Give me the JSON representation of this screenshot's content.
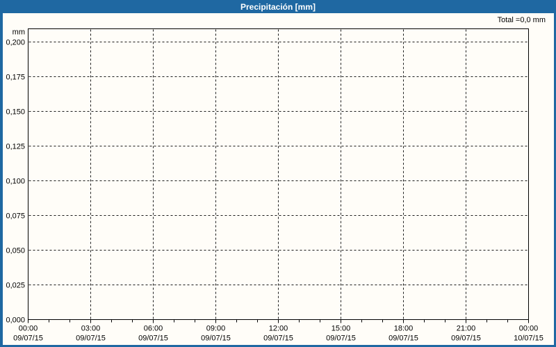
{
  "header": {
    "title": "Precipitación [mm]"
  },
  "summary": {
    "total_label": "Total =0,0 mm"
  },
  "chart_data": {
    "type": "line",
    "title": "Precipitación [mm]",
    "subtitle": "",
    "xlabel": "",
    "ylabel": "mm",
    "ylim": [
      0,
      0.21
    ],
    "y_tick_labels": [
      "0,200",
      "0,175",
      "0,150",
      "0,125",
      "0,100",
      "0,075",
      "0,050",
      "0,025",
      "0,000"
    ],
    "y_tick_values": [
      0.2,
      0.175,
      0.15,
      0.125,
      0.1,
      0.075,
      0.05,
      0.025,
      0.0
    ],
    "x_range": "00:00 09/07/15 to 00:00 10/07/15",
    "major_tick_interval_hours": 3,
    "minor_tick_interval_hours": 1,
    "x_major_ticks": [
      {
        "time": "00:00",
        "date": "09/07/15"
      },
      {
        "time": "03:00",
        "date": "09/07/15"
      },
      {
        "time": "06:00",
        "date": "09/07/15"
      },
      {
        "time": "09:00",
        "date": "09/07/15"
      },
      {
        "time": "12:00",
        "date": "09/07/15"
      },
      {
        "time": "15:00",
        "date": "09/07/15"
      },
      {
        "time": "18:00",
        "date": "09/07/15"
      },
      {
        "time": "21:00",
        "date": "09/07/15"
      },
      {
        "time": "00:00",
        "date": "10/07/15"
      }
    ],
    "grid": "dashed",
    "legend": "none",
    "series": [
      {
        "name": "Precipitación",
        "values": [],
        "total_label": "Total =0,0 mm",
        "total_mm": 0.0
      }
    ],
    "colors": {
      "frame_blue": "#1f68a2",
      "background": "#fffdf8",
      "axis": "#000000",
      "gridline": "#1a1a1a",
      "title_text": "#ffffff",
      "label_text": "#000000"
    }
  }
}
